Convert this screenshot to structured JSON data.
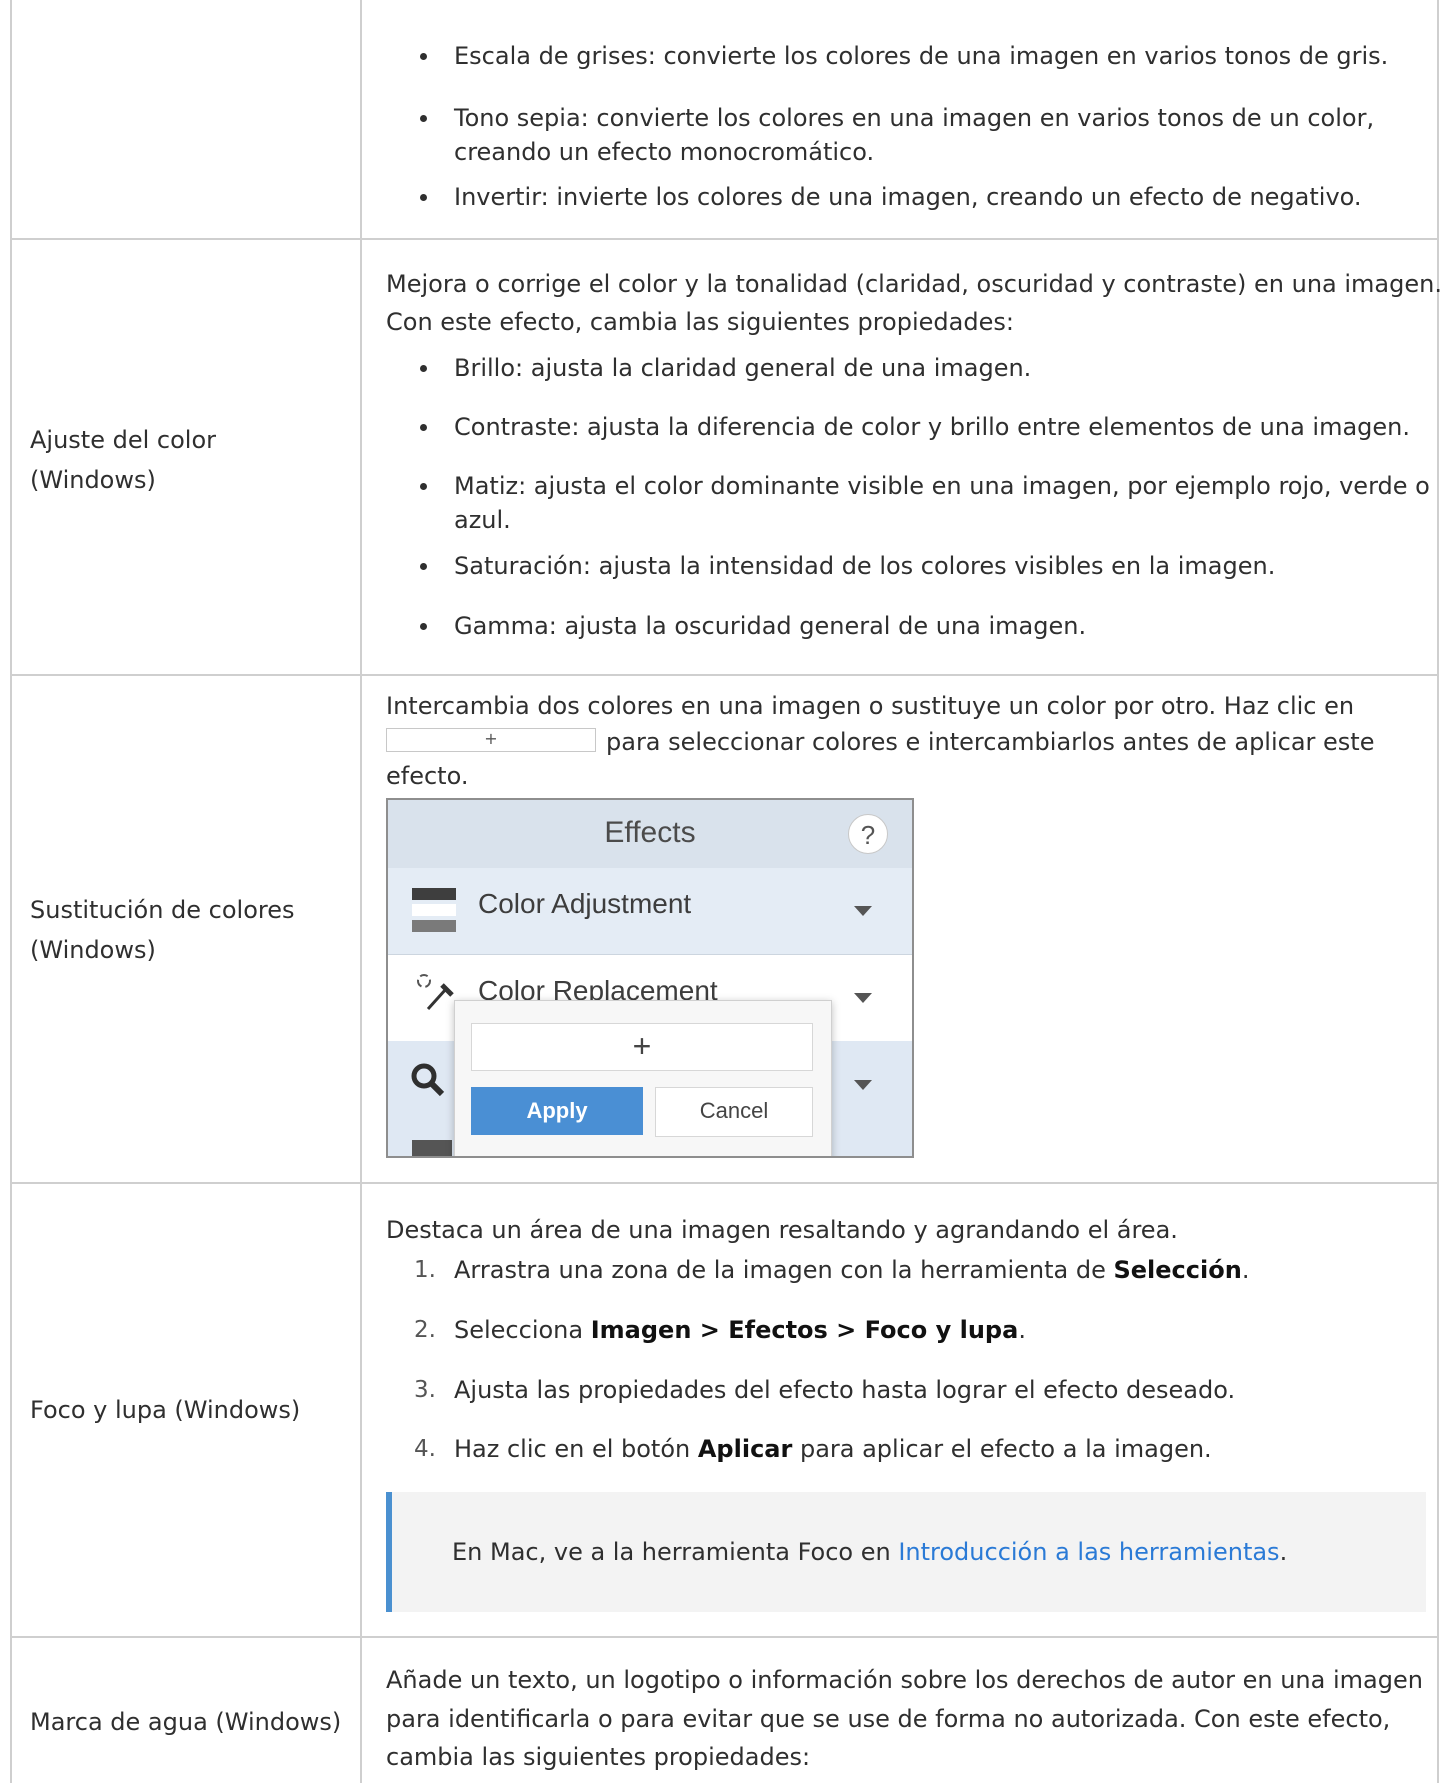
{
  "rows": [
    {
      "label": "",
      "bullets": [
        "Escala de grises: convierte los colores de una imagen en varios tonos de gris.",
        "Tono sepia: convierte los colores en una imagen en varios tonos de un color,",
        "creando un efecto monocromático.",
        "Invertir: invierte los colores de una imagen, creando un efecto de negativo."
      ]
    },
    {
      "label_line1": "Ajuste del color",
      "label_line2": "(Windows)",
      "intro_line1": "Mejora o corrige el color y la tonalidad (claridad, oscuridad y contraste) en una imagen.",
      "intro_line2": "Con este efecto, cambia las siguientes propiedades:",
      "bullets": [
        "Brillo: ajusta la claridad general de una imagen.",
        "Contraste: ajusta la diferencia de color y brillo entre elementos de una imagen.",
        "Matiz: ajusta el color dominante visible en una imagen, por ejemplo rojo, verde o",
        "azul.",
        "Saturación: ajusta la intensidad de los colores visibles en la imagen.",
        "Gamma: ajusta la oscuridad general de una imagen."
      ]
    },
    {
      "label_line1": "Sustitución de colores",
      "label_line2": "(Windows)",
      "text_line1": "Intercambia dos colores en una imagen o sustituye un color por otro. Haz clic en",
      "inline_button": "+",
      "text_line2": "para seleccionar colores e intercambiarlos antes de aplicar este",
      "text_line3": "efecto.",
      "screenshot": {
        "title": "Effects",
        "help": "?",
        "item1": "Color Adjustment",
        "item2": "Color Replacement",
        "plus": "+",
        "apply": "Apply",
        "cancel": "Cancel"
      }
    },
    {
      "label": "Foco y lupa (Windows)",
      "intro": "Destaca un área de una imagen resaltando y agrandando el área.",
      "steps": [
        {
          "num": "1.",
          "pre": "Arrastra una zona de la imagen con la herramienta de ",
          "bold": "Selección",
          "post": "."
        },
        {
          "num": "2.",
          "pre": "Selecciona ",
          "bold": "Imagen > Efectos > Foco y lupa",
          "post": "."
        },
        {
          "num": "3.",
          "pre": "Ajusta las propiedades del efecto hasta lograr el efecto deseado.",
          "bold": "",
          "post": ""
        },
        {
          "num": "4.",
          "pre": "Haz clic en el botón ",
          "bold": "Aplicar",
          "post": " para aplicar el efecto a la imagen."
        }
      ],
      "note_pre": "En Mac, ve a la herramienta Foco en ",
      "note_link": "Introducción a las herramientas",
      "note_post": "."
    },
    {
      "label": "Marca de agua (Windows)",
      "text_line1": "Añade un texto, un logotipo o información sobre los derechos de autor en una imagen",
      "text_line2": "para identificarla o para evitar que se use de forma no autorizada. Con este efecto,",
      "text_line3": "cambia las siguientes propiedades:"
    }
  ],
  "colors": {
    "border": "#cfcfcf",
    "text": "#2f2f2f",
    "link": "#2a7ad6",
    "note_bg": "#f3f3f3",
    "note_bar": "#4a90d0",
    "apply_btn": "#4a8fd4"
  }
}
